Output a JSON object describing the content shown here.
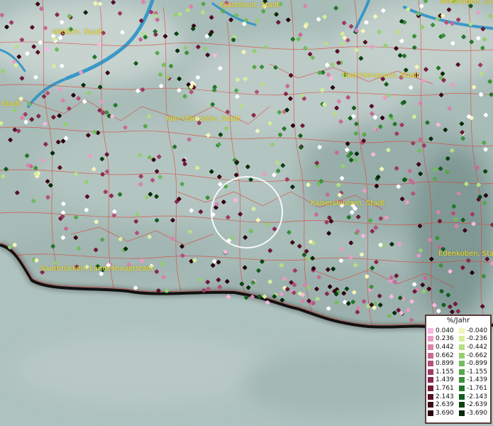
{
  "cities": [
    {
      "name": "Kastellaun, Stadt"
    },
    {
      "name": "Wiesbaden, La"
    },
    {
      "name": "Wittlich, Stadt"
    },
    {
      "name": "Bad Kreuznach, Stadt"
    },
    {
      "name": "Stadt"
    },
    {
      "name": "Idar-Oberstein, Stadt"
    },
    {
      "name": "Kaiserslautern, Stadt"
    },
    {
      "name": "Edenkoben, Sta"
    },
    {
      "name": "Saarbrücken, Landeshauptstadt"
    }
  ],
  "legend": {
    "unit": "%/Jahr",
    "positive": [
      {
        "label": "0.040",
        "color": "#f7b8e0"
      },
      {
        "label": "0.236",
        "color": "#e99cc7"
      },
      {
        "label": "0.442",
        "color": "#d983ae"
      },
      {
        "label": "0.662",
        "color": "#c76a95"
      },
      {
        "label": "0.899",
        "color": "#b4517c"
      },
      {
        "label": "1.155",
        "color": "#9e3b63"
      },
      {
        "label": "1.439",
        "color": "#872a4d"
      },
      {
        "label": "1.761",
        "color": "#6e1a37"
      },
      {
        "label": "2.143",
        "color": "#560f26"
      },
      {
        "label": "2.639",
        "color": "#3e0718"
      },
      {
        "label": "3.690",
        "color": "#28030e"
      }
    ],
    "negative": [
      {
        "label": "-0.040",
        "color": "#f2f5b8"
      },
      {
        "label": "-0.236",
        "color": "#d6ee9c"
      },
      {
        "label": "-0.442",
        "color": "#b5df86"
      },
      {
        "label": "-0.662",
        "color": "#93cf70"
      },
      {
        "label": "-0.899",
        "color": "#72bd5c"
      },
      {
        "label": "-1.155",
        "color": "#54a84a"
      },
      {
        "label": "-1.439",
        "color": "#3a9039"
      },
      {
        "label": "-1.761",
        "color": "#24762b"
      },
      {
        "label": "-2.143",
        "color": "#145c1e"
      },
      {
        "label": "-2.639",
        "color": "#094313"
      },
      {
        "label": "-3.690",
        "color": "#042b0b"
      }
    ]
  },
  "colors": {
    "terrain": "#a7bcb8",
    "lowland": "#aec3c0",
    "water": "#2c92c6",
    "borders": "#e0392f",
    "state_border": "#111111",
    "label": "#f4e21c",
    "highlight_circle": "#ffffff",
    "neutral_point": "#ffffff"
  }
}
